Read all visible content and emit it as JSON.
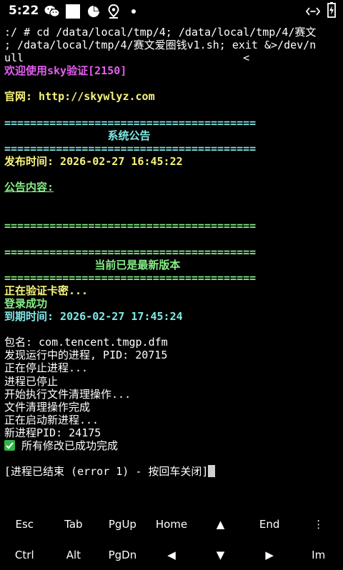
{
  "status_bar": {
    "time": "5:22",
    "icons": [
      "wechat-icon",
      "white-square-icon",
      "pie-chart-icon",
      "location-icon",
      "dot-icon",
      "data-transfer-icon",
      "battery-charging-icon"
    ]
  },
  "terminal": {
    "lines": [
      {
        "text": ":/ # cd /data/local/tmp/4; /data/local/tmp/4/赛文",
        "style": ""
      },
      {
        "text": "; /data/local/tmp/4/赛文爱圈钱v1.sh; exit &>/dev/n",
        "style": ""
      },
      {
        "text": "ull                                  <",
        "style": ""
      },
      {
        "text": "欢迎使用sky验证[2150]",
        "style": "magenta"
      },
      {
        "text": "",
        "style": ""
      },
      {
        "text": "官网: http://skywlyz.com",
        "style": "yellow"
      },
      {
        "text": "",
        "style": ""
      },
      {
        "text": "=======================================",
        "style": "cyan"
      },
      {
        "text": "                系统公告",
        "style": "cyan"
      },
      {
        "text": "=======================================",
        "style": "cyan"
      },
      {
        "text": "发布时间: 2026-02-27 16:45:22",
        "style": "yellow"
      },
      {
        "text": "",
        "style": ""
      },
      {
        "text": "公告内容:",
        "style": "green underline"
      },
      {
        "text": "",
        "style": ""
      },
      {
        "text": "",
        "style": ""
      },
      {
        "text": "=======================================",
        "style": "green"
      },
      {
        "text": "",
        "style": ""
      },
      {
        "text": "=======================================",
        "style": "green"
      },
      {
        "text": "              当前已是最新版本",
        "style": "green"
      },
      {
        "text": "=======================================",
        "style": "green"
      },
      {
        "text": "正在验证卡密...",
        "style": "yellow"
      },
      {
        "text": "登录成功",
        "style": "green"
      },
      {
        "text": "到期时间: 2026-02-27 17:45:24",
        "style": "cyan"
      },
      {
        "text": "",
        "style": ""
      },
      {
        "text": "包名: com.tencent.tmgp.dfm",
        "style": ""
      },
      {
        "text": "发现运行中的进程, PID: 20715",
        "style": ""
      },
      {
        "text": "正在停止进程...",
        "style": ""
      },
      {
        "text": "进程已停止",
        "style": ""
      },
      {
        "text": "开始执行文件清理操作...",
        "style": ""
      },
      {
        "text": "文件清理操作完成",
        "style": ""
      },
      {
        "text": "正在启动新进程...",
        "style": ""
      },
      {
        "text": "新进程PID: 24175",
        "style": ""
      },
      {
        "text": " 所有修改已成功完成",
        "style": "",
        "check": true
      },
      {
        "text": "",
        "style": ""
      },
      {
        "text": "[进程已结束 (error 1) - 按回车关闭]",
        "style": "",
        "cursor": true
      }
    ]
  },
  "extra_keys": {
    "row1": [
      {
        "label": "Esc",
        "name": "key-esc"
      },
      {
        "label": "Tab",
        "name": "key-tab"
      },
      {
        "label": "PgUp",
        "name": "key-pgup"
      },
      {
        "label": "Home",
        "name": "key-home"
      },
      {
        "label": "▲",
        "name": "key-arrow-up"
      },
      {
        "label": "End",
        "name": "key-end"
      },
      {
        "label": "⋮",
        "name": "key-more"
      }
    ],
    "row2": [
      {
        "label": "Ctrl",
        "name": "key-ctrl"
      },
      {
        "label": "Alt",
        "name": "key-alt"
      },
      {
        "label": "PgDn",
        "name": "key-pgdn"
      },
      {
        "label": "◀",
        "name": "key-arrow-left"
      },
      {
        "label": "▼",
        "name": "key-arrow-down"
      },
      {
        "label": "▶",
        "name": "key-arrow-right"
      },
      {
        "label": "Im",
        "name": "key-im"
      }
    ]
  }
}
